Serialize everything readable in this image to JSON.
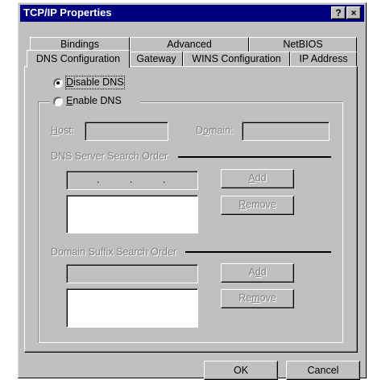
{
  "window": {
    "title": "TCP/IP Properties",
    "help_glyph": "?",
    "close_glyph": "×"
  },
  "tabs_back": [
    "Bindings",
    "Advanced",
    "NetBIOS"
  ],
  "tabs_front": [
    "DNS Configuration",
    "Gateway",
    "WINS Configuration",
    "IP Address"
  ],
  "dns": {
    "disable_label_first": "D",
    "disable_label_rest": "isable DNS",
    "enable_label_first": "E",
    "enable_label_rest": "nable DNS",
    "selected": "disable",
    "host_label_first": "H",
    "host_label_rest": "ost:",
    "domain_label_pre": "D",
    "domain_label_u": "o",
    "domain_label_rest": "main:",
    "server_order_title": "DNS Server Search Order",
    "ip_dots": [
      ".",
      ".",
      "."
    ],
    "add1_u": "A",
    "add1_rest": "dd",
    "remove1_u": "R",
    "remove1_rest": "emove",
    "suffix_order_title": "Domain Suffix Search Order",
    "add2_pre": "A",
    "add2_u": "d",
    "add2_rest": "d",
    "remove2_pre": "Re",
    "remove2_u": "m",
    "remove2_rest": "ove"
  },
  "footer": {
    "ok": "OK",
    "cancel": "Cancel"
  }
}
